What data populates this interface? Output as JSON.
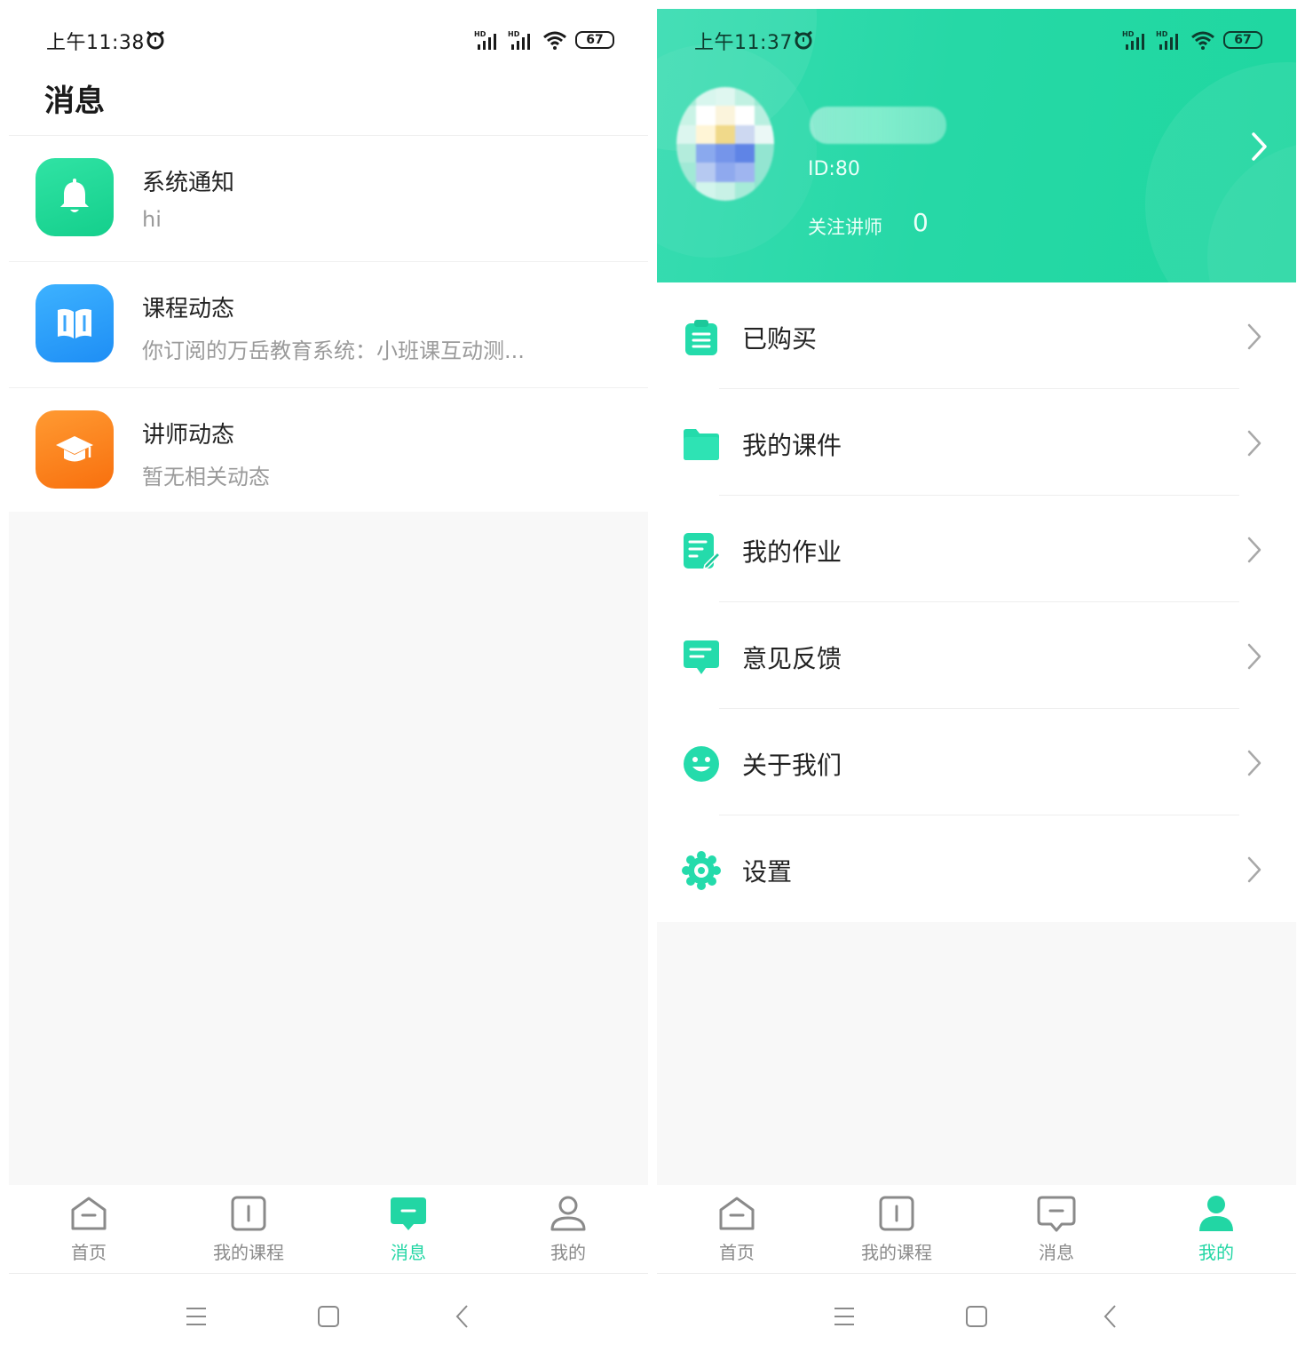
{
  "colors": {
    "accent": "#22d6a4",
    "header_green": "#26d8a6",
    "tab_inactive": "#8a8a8a",
    "sub_text": "#9a9a9a",
    "background_grey": "#f8f8f8",
    "system_notice_icon": "#21d69a",
    "course_icon": "#2a9cf8",
    "teacher_icon": "#fb7e1e"
  },
  "left_screen": {
    "status_bar": {
      "time": "上午11:38",
      "battery": "67"
    },
    "page_title": "消息",
    "messages": [
      {
        "title": "系统通知",
        "subtitle": "hi",
        "icon": "bell-icon"
      },
      {
        "title": "课程动态",
        "subtitle": "你订阅的万岳教育系统：小班课互动测...",
        "icon": "book-icon"
      },
      {
        "title": "讲师动态",
        "subtitle": "暂无相关动态",
        "icon": "graduation-cap-icon"
      }
    ],
    "tab_bar": {
      "tabs": [
        {
          "label": "首页",
          "icon": "home-icon",
          "active": false
        },
        {
          "label": "我的课程",
          "icon": "course-icon",
          "active": false
        },
        {
          "label": "消息",
          "icon": "message-icon",
          "active": true
        },
        {
          "label": "我的",
          "icon": "user-icon",
          "active": false
        }
      ]
    }
  },
  "right_screen": {
    "status_bar": {
      "time": "上午11:37",
      "battery": "67"
    },
    "profile": {
      "id_text": "ID:80",
      "follow_label": "关注讲师",
      "follow_count": "0"
    },
    "menu": [
      {
        "label": "已购买",
        "icon": "clipboard-icon"
      },
      {
        "label": "我的课件",
        "icon": "folder-icon"
      },
      {
        "label": "我的作业",
        "icon": "homework-edit-icon"
      },
      {
        "label": "意见反馈",
        "icon": "feedback-icon"
      },
      {
        "label": "关于我们",
        "icon": "smile-icon"
      },
      {
        "label": "设置",
        "icon": "gear-icon"
      }
    ],
    "tab_bar": {
      "tabs": [
        {
          "label": "首页",
          "icon": "home-icon",
          "active": false
        },
        {
          "label": "我的课程",
          "icon": "course-icon",
          "active": false
        },
        {
          "label": "消息",
          "icon": "message-icon",
          "active": false
        },
        {
          "label": "我的",
          "icon": "user-icon",
          "active": true
        }
      ]
    }
  }
}
